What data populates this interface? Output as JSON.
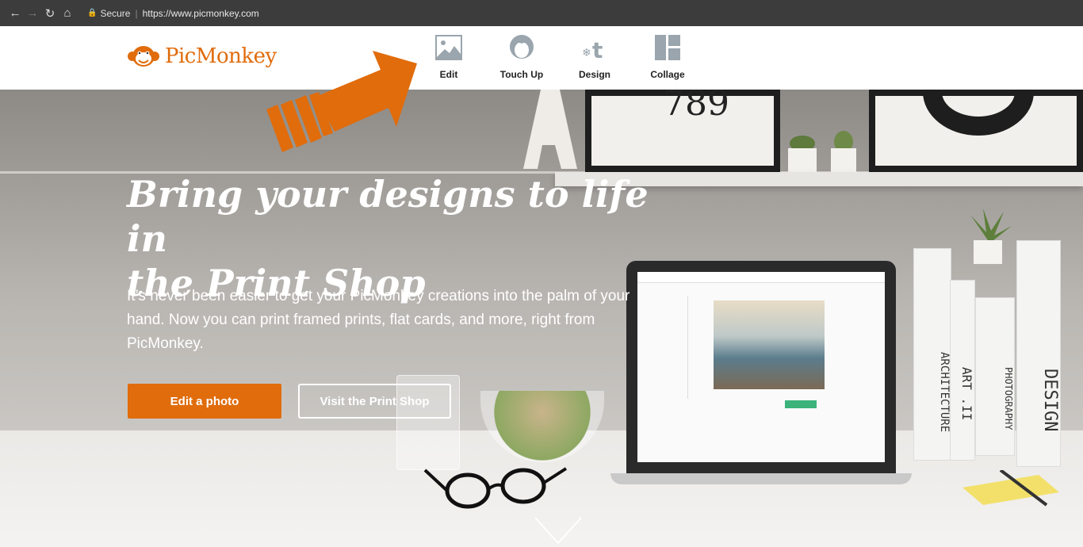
{
  "browser": {
    "secure_label": "Secure",
    "url": "https://www.picmonkey.com"
  },
  "brand": {
    "name": "PicMonkey",
    "accent_color": "#e06c0c"
  },
  "nav": {
    "items": [
      {
        "label": "Edit",
        "icon": "photo-icon"
      },
      {
        "label": "Touch Up",
        "icon": "face-icon"
      },
      {
        "label": "Design",
        "icon": "design-icon"
      },
      {
        "label": "Collage",
        "icon": "collage-icon"
      }
    ]
  },
  "hero": {
    "headline_line1": "Bring your designs to life in",
    "headline_line2": "the Print Shop",
    "subtext": "It’s never been easier to get your PicMonkey creations into the palm of your hand. Now you can print framed prints, flat cards, and more, right from PicMonkey.",
    "primary_button": "Edit a photo",
    "secondary_button": "Visit the Print Shop"
  },
  "scene": {
    "frame_number": "789",
    "books": [
      "ARCHITECTURE",
      "ART .II",
      "PHOTOGRAPHY",
      "DESIGN"
    ]
  }
}
